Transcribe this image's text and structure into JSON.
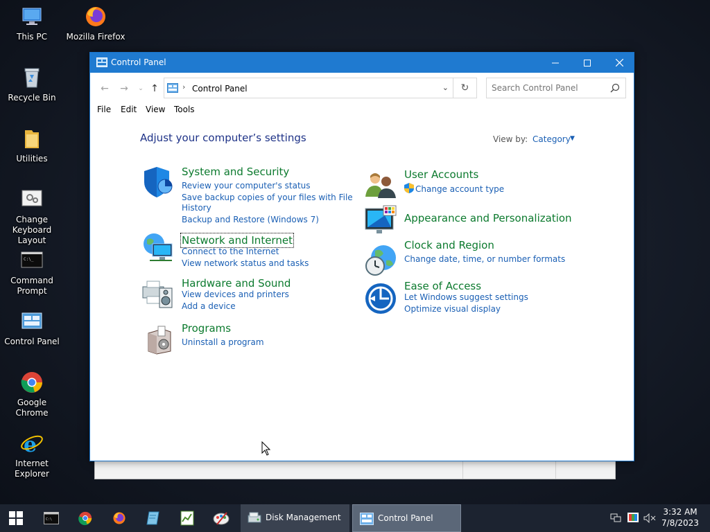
{
  "desktop": {
    "icons": [
      {
        "label": "This PC"
      },
      {
        "label": "Mozilla Firefox"
      },
      {
        "label": "Recycle Bin"
      },
      {
        "label": "Utilities"
      },
      {
        "label": "Change Keyboard Layout"
      },
      {
        "label": "Command Prompt"
      },
      {
        "label": "Control Panel"
      },
      {
        "label": "Google Chrome"
      },
      {
        "label": "Internet Explorer"
      }
    ]
  },
  "window": {
    "title": "Control Panel",
    "address": {
      "breadcrumb": "Control Panel"
    },
    "search": {
      "placeholder": "Search Control Panel"
    },
    "menu": [
      "File",
      "Edit",
      "View",
      "Tools"
    ],
    "heading": "Adjust your computer’s settings",
    "view_by": {
      "label": "View by:",
      "value": "Category"
    },
    "categories": [
      {
        "title": "System and Security",
        "links": [
          "Review your computer's status",
          "Save backup copies of your files with File",
          "History",
          "Backup and Restore (Windows 7)"
        ]
      },
      {
        "title": "Network and Internet",
        "links": [
          "Connect to the Internet",
          "View network status and tasks"
        ]
      },
      {
        "title": "Hardware and Sound",
        "links": [
          "View devices and printers",
          "Add a device"
        ]
      },
      {
        "title": "Programs",
        "links": [
          "Uninstall a program"
        ]
      },
      {
        "title": "User Accounts",
        "links": [
          "Change account type"
        ]
      },
      {
        "title": "Appearance and Personalization",
        "links": []
      },
      {
        "title": "Clock and Region",
        "links": [
          "Change date, time, or number formats"
        ]
      },
      {
        "title": "Ease of Access",
        "links": [
          "Let Windows suggest settings",
          "Optimize visual display"
        ]
      }
    ]
  },
  "taskbar": {
    "tasks": [
      {
        "label": "Disk Management"
      },
      {
        "label": "Control Panel"
      }
    ],
    "clock": {
      "time": "3:32 AM",
      "date": "7/8/2023"
    }
  },
  "colors": {
    "titlebar": "#1f7ad0",
    "link": "#1a5fb4",
    "category_title": "#0c7a2e",
    "heading": "#1e3287",
    "taskbar": "#1c2330"
  }
}
